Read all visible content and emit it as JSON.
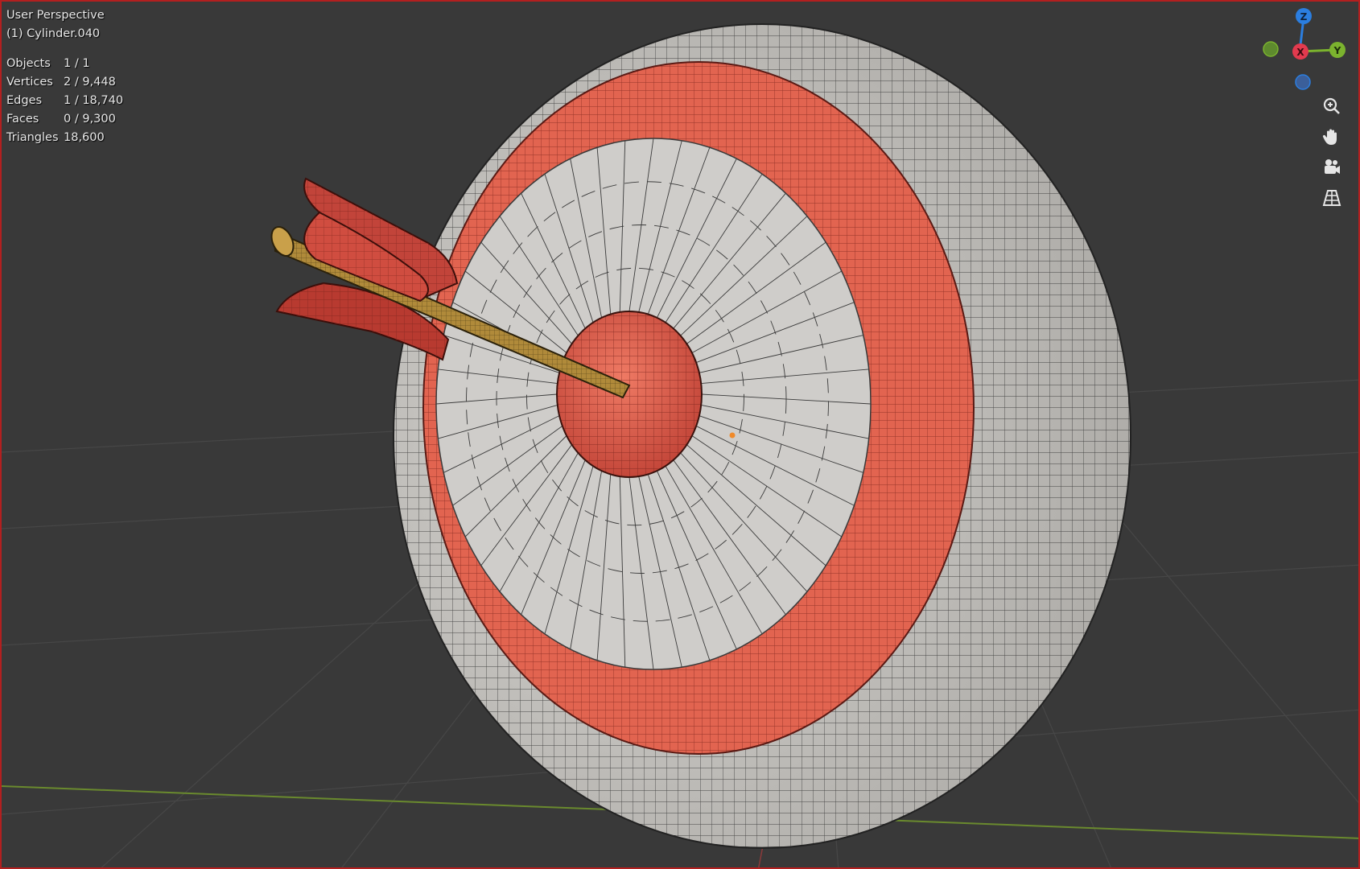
{
  "viewport": {
    "view_name": "User Perspective",
    "object_name": "(1) Cylinder.040",
    "stats": [
      {
        "label": "Objects",
        "value": "1 / 1"
      },
      {
        "label": "Vertices",
        "value": "2 / 9,448"
      },
      {
        "label": "Edges",
        "value": "1 / 18,740"
      },
      {
        "label": "Faces",
        "value": "0 / 9,300"
      },
      {
        "label": "Triangles",
        "value": "18,600"
      }
    ]
  },
  "gizmo": {
    "axis_z": "Z",
    "axis_x": "X",
    "axis_y": "Y",
    "colors": {
      "z": "#2b7ee0",
      "x": "#e23a4e",
      "y": "#7bb32e",
      "z_neg": "#3b5f9a",
      "y_neg": "#5e8a2e"
    }
  },
  "nav_buttons": [
    {
      "name": "zoom-icon"
    },
    {
      "name": "pan-hand-icon"
    },
    {
      "name": "camera-icon"
    },
    {
      "name": "ortho-grid-icon"
    }
  ],
  "scene_colors": {
    "background": "#393939",
    "grid": "#4a4a4a",
    "x_axis_line": "#8a3a3a",
    "y_axis_line": "#6a8a2e",
    "target_white": "#cfcdca",
    "target_red": "#e26450",
    "arrow_shaft": "#b08a3a",
    "fletching": "#c2443a"
  }
}
